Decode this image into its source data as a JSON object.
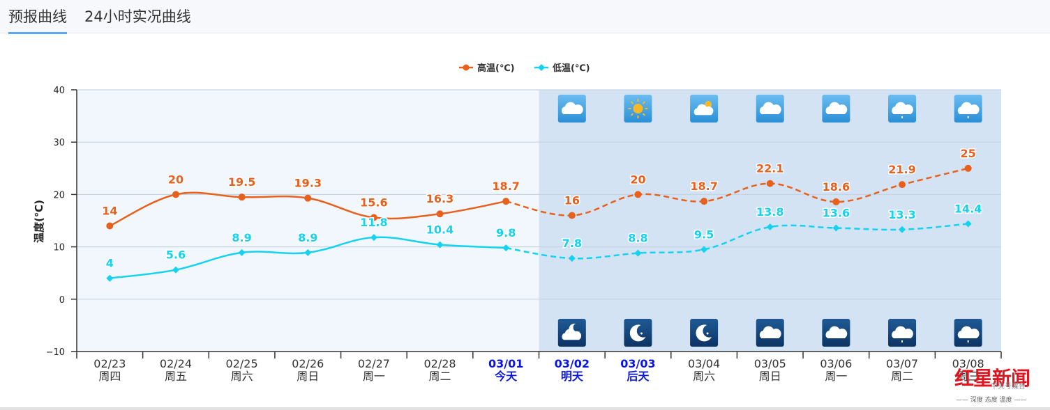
{
  "tabs": [
    {
      "label": "预报曲线",
      "active": true
    },
    {
      "label": "24小时实况曲线",
      "active": false
    }
  ],
  "watermark": {
    "brand": "红星新闻",
    "sub": "中央号媒台",
    "slogan": "—— 深度 态度 温度 ——"
  },
  "colors": {
    "high": "#e8601c",
    "low": "#14d2f0",
    "highlight_date": "#0a14e6",
    "history_bg": "#f1f7fd",
    "forecast_bg": "#d3e3f4",
    "tab_underline": "#5aa7ec"
  },
  "chart_data": {
    "type": "line",
    "title": "",
    "xlabel": "",
    "ylabel": "温度(℃)",
    "ylim": [
      -10,
      40
    ],
    "yticks": [
      -10,
      0,
      10,
      20,
      30,
      40
    ],
    "grid": true,
    "legend_position": "top-center",
    "categories": [
      "02/23",
      "02/24",
      "02/25",
      "02/26",
      "02/27",
      "02/28",
      "03/01",
      "03/02",
      "03/03",
      "03/04",
      "03/05",
      "03/06",
      "03/07",
      "03/08"
    ],
    "weekdays": [
      "周四",
      "周五",
      "周六",
      "周日",
      "周一",
      "周二",
      "今天",
      "明天",
      "后天",
      "周六",
      "周日",
      "周一",
      "周二",
      "周三"
    ],
    "highlighted_categories": [
      "03/01",
      "03/02",
      "03/03"
    ],
    "forecast_starts_after": "03/01",
    "series": [
      {
        "name": "高温(℃)",
        "marker": "circle",
        "values": [
          14,
          20,
          19.5,
          19.3,
          15.6,
          16.3,
          18.7,
          16,
          20,
          18.7,
          22.1,
          18.6,
          21.9,
          25
        ]
      },
      {
        "name": "低温(℃)",
        "marker": "diamond",
        "values": [
          4,
          5.6,
          8.9,
          8.9,
          11.8,
          10.4,
          9.8,
          7.8,
          8.8,
          9.5,
          13.8,
          13.6,
          13.3,
          14.4
        ]
      }
    ],
    "day_weather_icons": {
      "03/02": "cloudy-icon",
      "03/03": "sunny-icon",
      "03/04": "partly-cloudy-day-icon",
      "03/05": "cloudy-icon",
      "03/06": "cloudy-icon",
      "03/07": "light-rain-icon",
      "03/08": "light-rain-icon"
    },
    "night_weather_icons": {
      "03/02": "partly-cloudy-night-icon",
      "03/03": "clear-night-icon",
      "03/04": "clear-night-icon",
      "03/05": "cloudy-icon",
      "03/06": "cloudy-icon",
      "03/07": "light-rain-icon",
      "03/08": "light-rain-icon"
    }
  }
}
